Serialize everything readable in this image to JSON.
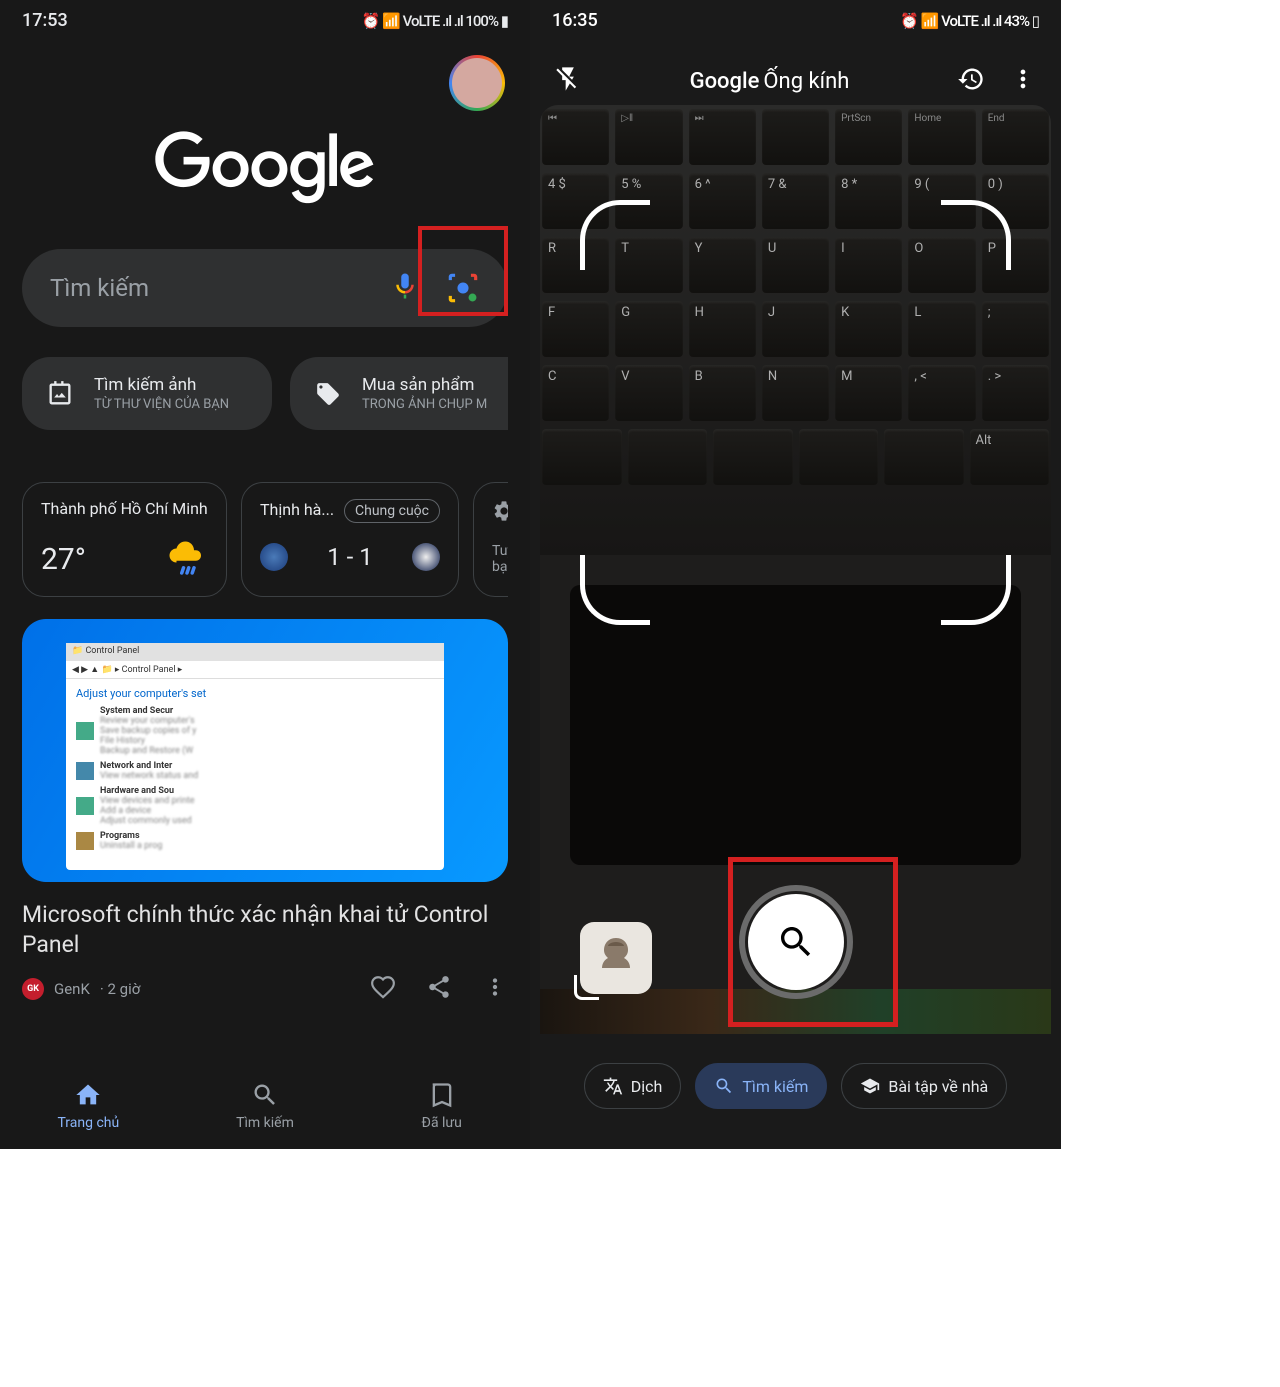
{
  "screen1": {
    "status": {
      "time": "17:53",
      "right": "⏰ 📶 VoLTE .ıl .ıl 100% ▮"
    },
    "logo": "Google",
    "search": {
      "placeholder": "Tìm kiếm"
    },
    "quick": [
      {
        "title": "Tìm kiếm ảnh",
        "desc": "TỪ THƯ VIỆN CỦA BẠN"
      },
      {
        "title": "Mua sản phẩm",
        "desc": "TRONG ẢNH CHỤP M"
      }
    ],
    "weather": {
      "city": "Thành phố Hồ Chí Minh",
      "temp": "27°"
    },
    "sport": {
      "label": "Thịnh hà...",
      "badge": "Chung cuộc",
      "score": "1 - 1"
    },
    "settings_card": "Tuỳ",
    "settings_card2": "bạn",
    "news": {
      "cp_title": "Control Panel",
      "cp_path": "◀ ▶ ▲ 📁 ▸ Control Panel ▸",
      "cp_adjust": "Adjust your computer's set",
      "cp_items": [
        "System and Secur",
        "Network and Inter",
        "Hardware and Sou",
        "Programs"
      ],
      "title": "Microsoft chính thức xác nhận khai tử Control Panel",
      "source": "GenK",
      "time": "· 2 giờ",
      "source_badge": "GK"
    },
    "nav": [
      {
        "label": "Trang chủ"
      },
      {
        "label": "Tìm kiếm"
      },
      {
        "label": "Đã lưu"
      }
    ]
  },
  "screen2": {
    "status": {
      "time": "16:35",
      "right": "⏰ 📶 VoLTE .ıl .ıl 43% ▯"
    },
    "title_google": "Google",
    "title_rest": " Ống kính",
    "keys_top": [
      "⏮",
      "▷‖",
      "⏭",
      "",
      "PrtScn",
      "Home",
      "End"
    ],
    "keys_num": [
      "4 $",
      "5 %",
      "6 ^",
      "7 &",
      "8 *",
      "9 (",
      "0 )"
    ],
    "keys_r1": [
      "R",
      "T",
      "Y",
      "U",
      "I",
      "O",
      "P"
    ],
    "keys_r2": [
      "F",
      "G",
      "H",
      "J",
      "K",
      "L",
      ";"
    ],
    "keys_r3": [
      "C",
      "V",
      "B",
      "N",
      "M",
      ", <",
      ". >"
    ],
    "keys_r4": [
      "",
      "",
      "",
      "",
      "",
      "Alt"
    ],
    "modes": [
      {
        "icon": "translate",
        "label": "Dịch"
      },
      {
        "icon": "search",
        "label": "Tìm kiếm"
      },
      {
        "icon": "homework",
        "label": "Bài tập về nhà"
      }
    ]
  }
}
